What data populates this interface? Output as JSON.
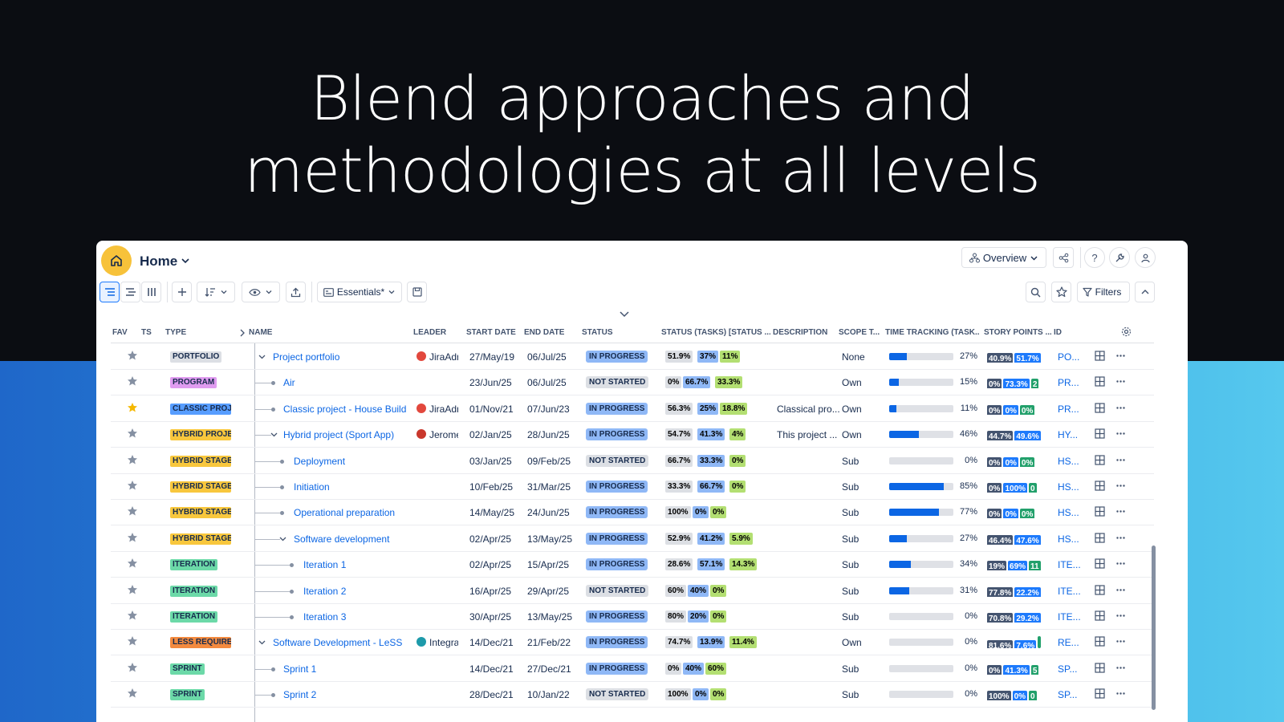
{
  "headline": [
    "Blend approaches and",
    "methodologies at all levels"
  ],
  "app": {
    "home_title": "Home",
    "overview_label": "Overview",
    "view_label": "Essentials*",
    "filters_label": "Filters"
  },
  "columns": [
    "FAV",
    "TS",
    "TYPE",
    "NAME",
    "LEADER",
    "START DATE",
    "END DATE",
    "STATUS",
    "STATUS (TASKS) [STATUS ...",
    "DESCRIPTION",
    "SCOPE T...",
    "TIME TRACKING (TASK...",
    "STORY POINTS ...",
    "ID"
  ],
  "colors": {
    "in_progress": "#8fb8f6",
    "not_started": "#dcdfe4",
    "seg_grey": "#dcdfe4",
    "seg_blue": "#8fb8f6",
    "seg_green": "#b3df72",
    "sp_dark": "#44546f",
    "sp_blue": "#1d7afc",
    "sp_green": "#22a06b"
  },
  "rows": [
    {
      "type": "PORTFOLIO",
      "type_bg": "#dcdfe4",
      "name": "Project portfolio",
      "level": 0,
      "expand": true,
      "fav": false,
      "leader": "JiraAdr",
      "leader_color": "#e2483d",
      "start": "27/May/19",
      "end": "06/Jul/25",
      "status": "IN PROGRESS",
      "segs": [
        "51.9%",
        "37%",
        "11%"
      ],
      "desc": "",
      "scope": "None",
      "tt": 27,
      "tt_label": "27%",
      "sp": [
        "40.9%",
        "51.7%"
      ],
      "id": "PO..."
    },
    {
      "type": "PROGRAM",
      "type_bg": "#e09cf0",
      "name": "Air",
      "level": 1,
      "expand": false,
      "fav": false,
      "leader": "",
      "leader_color": "",
      "start": "23/Jun/25",
      "end": "06/Jul/25",
      "status": "NOT STARTED",
      "segs": [
        "0%",
        "66.7%",
        "33.3%"
      ],
      "desc": "",
      "scope": "Own",
      "tt": 15,
      "tt_label": "15%",
      "sp": [
        "0%",
        "73.3%",
        "2"
      ],
      "id": "PR..."
    },
    {
      "type": "CLASSIC PROJ",
      "type_bg": "#579dff",
      "name": "Classic project - House Build",
      "level": 1,
      "expand": false,
      "fav": true,
      "leader": "JiraAdr",
      "leader_color": "#e2483d",
      "start": "01/Nov/21",
      "end": "07/Jun/23",
      "status": "IN PROGRESS",
      "segs": [
        "56.3%",
        "25%",
        "18.8%"
      ],
      "desc": "Classical pro...",
      "scope": "Own",
      "tt": 11,
      "tt_label": "11%",
      "sp": [
        "0%",
        "0%",
        "0%"
      ],
      "id": "PR..."
    },
    {
      "type": "HYBRID PROJE",
      "type_bg": "#f8c73d",
      "name": "Hybrid project (Sport App)",
      "level": 1,
      "expand": true,
      "fav": false,
      "leader": "Jerome",
      "leader_color": "#c9372c",
      "start": "02/Jan/25",
      "end": "28/Jun/25",
      "status": "IN PROGRESS",
      "segs": [
        "54.7%",
        "41.3%",
        "4%"
      ],
      "desc": "This project ...",
      "scope": "Own",
      "tt": 46,
      "tt_label": "46%",
      "sp": [
        "44.7%",
        "49.6%"
      ],
      "id": "HY..."
    },
    {
      "type": "HYBRID STAGE",
      "type_bg": "#f8c73d",
      "name": "Deployment",
      "level": 2,
      "expand": false,
      "fav": false,
      "leader": "",
      "leader_color": "",
      "start": "03/Jan/25",
      "end": "09/Feb/25",
      "status": "NOT STARTED",
      "segs": [
        "66.7%",
        "33.3%",
        "0%"
      ],
      "desc": "",
      "scope": "Sub",
      "tt": 0,
      "tt_label": "0%",
      "sp": [
        "0%",
        "0%",
        "0%"
      ],
      "id": "HS..."
    },
    {
      "type": "HYBRID STAGE",
      "type_bg": "#f8c73d",
      "name": "Initiation",
      "level": 2,
      "expand": false,
      "fav": false,
      "leader": "",
      "leader_color": "",
      "start": "10/Feb/25",
      "end": "31/Mar/25",
      "status": "IN PROGRESS",
      "segs": [
        "33.3%",
        "66.7%",
        "0%"
      ],
      "desc": "",
      "scope": "Sub",
      "tt": 85,
      "tt_label": "85%",
      "sp": [
        "0%",
        "100%",
        "0"
      ],
      "id": "HS..."
    },
    {
      "type": "HYBRID STAGE",
      "type_bg": "#f8c73d",
      "name": "Operational preparation",
      "level": 2,
      "expand": false,
      "fav": false,
      "leader": "",
      "leader_color": "",
      "start": "14/May/25",
      "end": "24/Jun/25",
      "status": "IN PROGRESS",
      "segs": [
        "100%",
        "0%",
        "0%"
      ],
      "desc": "",
      "scope": "Sub",
      "tt": 77,
      "tt_label": "77%",
      "sp": [
        "0%",
        "0%",
        "0%"
      ],
      "id": "HS..."
    },
    {
      "type": "HYBRID STAGE",
      "type_bg": "#f8c73d",
      "name": "Software development",
      "level": 2,
      "expand": true,
      "fav": false,
      "leader": "",
      "leader_color": "",
      "start": "02/Apr/25",
      "end": "13/May/25",
      "status": "IN PROGRESS",
      "segs": [
        "52.9%",
        "41.2%",
        "5.9%"
      ],
      "desc": "",
      "scope": "Sub",
      "tt": 27,
      "tt_label": "27%",
      "sp": [
        "46.4%",
        "47.6%"
      ],
      "id": "HS..."
    },
    {
      "type": "ITERATION",
      "type_bg": "#6cd9a8",
      "name": "Iteration 1",
      "level": 3,
      "expand": false,
      "fav": false,
      "leader": "",
      "leader_color": "",
      "start": "02/Apr/25",
      "end": "15/Apr/25",
      "status": "IN PROGRESS",
      "segs": [
        "28.6%",
        "57.1%",
        "14.3%"
      ],
      "desc": "",
      "scope": "Sub",
      "tt": 34,
      "tt_label": "34%",
      "sp": [
        "19%",
        "69%",
        "11"
      ],
      "id": "ITE..."
    },
    {
      "type": "ITERATION",
      "type_bg": "#6cd9a8",
      "name": "Iteration 2",
      "level": 3,
      "expand": false,
      "fav": false,
      "leader": "",
      "leader_color": "",
      "start": "16/Apr/25",
      "end": "29/Apr/25",
      "status": "NOT STARTED",
      "segs": [
        "60%",
        "40%",
        "0%"
      ],
      "desc": "",
      "scope": "Sub",
      "tt": 31,
      "tt_label": "31%",
      "sp": [
        "77.8%",
        "22.2%"
      ],
      "id": "ITE..."
    },
    {
      "type": "ITERATION",
      "type_bg": "#6cd9a8",
      "name": "Iteration 3",
      "level": 3,
      "expand": false,
      "fav": false,
      "leader": "",
      "leader_color": "",
      "start": "30/Apr/25",
      "end": "13/May/25",
      "status": "IN PROGRESS",
      "segs": [
        "80%",
        "20%",
        "0%"
      ],
      "desc": "",
      "scope": "Sub",
      "tt": 0,
      "tt_label": "0%",
      "sp": [
        "70.8%",
        "29.2%"
      ],
      "id": "ITE..."
    },
    {
      "type": "LESS REQUIRE",
      "type_bg": "#f38a3f",
      "name": "Software Development - LeSS",
      "level": 0,
      "expand": true,
      "fav": false,
      "leader": "Integra",
      "leader_color": "#1d9aaa",
      "start": "14/Dec/21",
      "end": "21/Feb/22",
      "status": "IN PROGRESS",
      "segs": [
        "74.7%",
        "13.9%",
        "11.4%"
      ],
      "desc": "",
      "scope": "Own",
      "tt": 0,
      "tt_label": "0%",
      "sp": [
        "81.6%",
        "7.6%",
        ""
      ],
      "id": "RE..."
    },
    {
      "type": "SPRINT",
      "type_bg": "#6cd9a8",
      "name": "Sprint 1",
      "level": 1,
      "expand": false,
      "fav": false,
      "leader": "",
      "leader_color": "",
      "start": "14/Dec/21",
      "end": "27/Dec/21",
      "status": "IN PROGRESS",
      "segs": [
        "0%",
        "40%",
        "60%"
      ],
      "desc": "",
      "scope": "Sub",
      "tt": 0,
      "tt_label": "0%",
      "sp": [
        "0%",
        "41.3%",
        "5"
      ],
      "id": "SP..."
    },
    {
      "type": "SPRINT",
      "type_bg": "#6cd9a8",
      "name": "Sprint 2",
      "level": 1,
      "expand": false,
      "fav": false,
      "leader": "",
      "leader_color": "",
      "start": "28/Dec/21",
      "end": "10/Jan/22",
      "status": "NOT STARTED",
      "segs": [
        "100%",
        "0%",
        "0%"
      ],
      "desc": "",
      "scope": "Sub",
      "tt": 0,
      "tt_label": "0%",
      "sp": [
        "100%",
        "0%",
        "0"
      ],
      "id": "SP..."
    }
  ]
}
